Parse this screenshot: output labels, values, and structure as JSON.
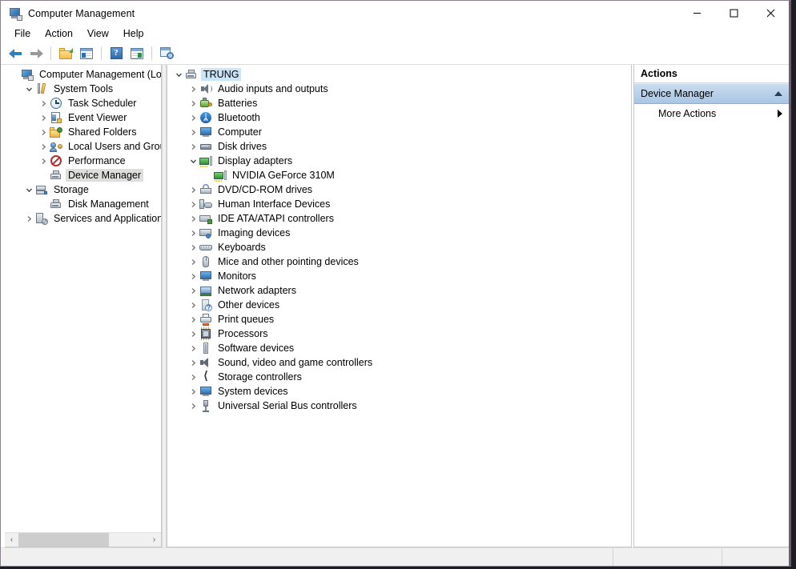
{
  "window": {
    "title": "Computer Management",
    "icon": "computer-management-icon",
    "controls": {
      "minimize": "minimize",
      "maximize": "maximize",
      "close": "close"
    }
  },
  "menubar": {
    "items": [
      {
        "label": "File"
      },
      {
        "label": "Action"
      },
      {
        "label": "View"
      },
      {
        "label": "Help"
      }
    ]
  },
  "toolbar": {
    "items": [
      {
        "name": "back-button",
        "icon": "back-arrow-icon"
      },
      {
        "name": "forward-button",
        "icon": "forward-arrow-icon"
      },
      {
        "name": "up-folder-button",
        "icon": "folder-up-icon"
      },
      {
        "name": "show-hide-tree-button",
        "icon": "console-tree-icon"
      },
      {
        "name": "help-button",
        "icon": "help-icon"
      },
      {
        "name": "show-hide-actions-button",
        "icon": "action-pane-icon"
      },
      {
        "name": "export-list-button",
        "icon": "export-list-icon"
      }
    ]
  },
  "console_tree": {
    "items": [
      {
        "label": "Computer Management (Local",
        "icon": "computer-management-icon",
        "indent": 0,
        "expander": "none",
        "selected": false
      },
      {
        "label": "System Tools",
        "icon": "system-tools-icon",
        "indent": 1,
        "expander": "expanded",
        "selected": false
      },
      {
        "label": "Task Scheduler",
        "icon": "clock-icon",
        "indent": 2,
        "expander": "collapsed",
        "selected": false
      },
      {
        "label": "Event Viewer",
        "icon": "event-viewer-icon",
        "indent": 2,
        "expander": "collapsed",
        "selected": false
      },
      {
        "label": "Shared Folders",
        "icon": "shared-folders-icon",
        "indent": 2,
        "expander": "collapsed",
        "selected": false
      },
      {
        "label": "Local Users and Groups",
        "icon": "users-icon",
        "indent": 2,
        "expander": "collapsed",
        "selected": false
      },
      {
        "label": "Performance",
        "icon": "performance-icon",
        "indent": 2,
        "expander": "collapsed",
        "selected": false
      },
      {
        "label": "Device Manager",
        "icon": "device-manager-icon",
        "indent": 2,
        "expander": "none",
        "selected": true
      },
      {
        "label": "Storage",
        "icon": "storage-icon",
        "indent": 1,
        "expander": "expanded",
        "selected": false
      },
      {
        "label": "Disk Management",
        "icon": "disk-management-icon",
        "indent": 2,
        "expander": "none",
        "selected": false
      },
      {
        "label": "Services and Applications",
        "icon": "services-icon",
        "indent": 1,
        "expander": "collapsed",
        "selected": false
      }
    ],
    "hscroll": {
      "left_arrow": "‹",
      "right_arrow": "›"
    }
  },
  "device_tree": {
    "items": [
      {
        "label": "TRUNG",
        "icon": "device-manager-icon",
        "indent": 0,
        "expander": "expanded",
        "selected": true
      },
      {
        "label": "Audio inputs and outputs",
        "icon": "speaker-icon",
        "indent": 1,
        "expander": "collapsed",
        "selected": false
      },
      {
        "label": "Batteries",
        "icon": "battery-icon",
        "indent": 1,
        "expander": "collapsed",
        "selected": false
      },
      {
        "label": "Bluetooth",
        "icon": "bluetooth-icon",
        "indent": 1,
        "expander": "collapsed",
        "selected": false
      },
      {
        "label": "Computer",
        "icon": "computer-icon",
        "indent": 1,
        "expander": "collapsed",
        "selected": false
      },
      {
        "label": "Disk drives",
        "icon": "disk-drive-icon",
        "indent": 1,
        "expander": "collapsed",
        "selected": false
      },
      {
        "label": "Display adapters",
        "icon": "display-adapter-icon",
        "indent": 1,
        "expander": "expanded",
        "selected": false
      },
      {
        "label": "NVIDIA GeForce 310M",
        "icon": "display-adapter-icon",
        "indent": 2,
        "expander": "none",
        "selected": false
      },
      {
        "label": "DVD/CD-ROM drives",
        "icon": "dvd-drive-icon",
        "indent": 1,
        "expander": "collapsed",
        "selected": false
      },
      {
        "label": "Human Interface Devices",
        "icon": "hid-icon",
        "indent": 1,
        "expander": "collapsed",
        "selected": false
      },
      {
        "label": "IDE ATA/ATAPI controllers",
        "icon": "ide-controller-icon",
        "indent": 1,
        "expander": "collapsed",
        "selected": false
      },
      {
        "label": "Imaging devices",
        "icon": "imaging-device-icon",
        "indent": 1,
        "expander": "collapsed",
        "selected": false
      },
      {
        "label": "Keyboards",
        "icon": "keyboard-icon",
        "indent": 1,
        "expander": "collapsed",
        "selected": false
      },
      {
        "label": "Mice and other pointing devices",
        "icon": "mouse-icon",
        "indent": 1,
        "expander": "collapsed",
        "selected": false
      },
      {
        "label": "Monitors",
        "icon": "monitor-icon",
        "indent": 1,
        "expander": "collapsed",
        "selected": false
      },
      {
        "label": "Network adapters",
        "icon": "network-adapter-icon",
        "indent": 1,
        "expander": "collapsed",
        "selected": false
      },
      {
        "label": "Other devices",
        "icon": "other-device-icon",
        "indent": 1,
        "expander": "collapsed",
        "selected": false
      },
      {
        "label": "Print queues",
        "icon": "printer-icon",
        "indent": 1,
        "expander": "collapsed",
        "selected": false
      },
      {
        "label": "Processors",
        "icon": "processor-icon",
        "indent": 1,
        "expander": "collapsed",
        "selected": false
      },
      {
        "label": "Software devices",
        "icon": "software-device-icon",
        "indent": 1,
        "expander": "collapsed",
        "selected": false
      },
      {
        "label": "Sound, video and game controllers",
        "icon": "sound-video-game-icon",
        "indent": 1,
        "expander": "collapsed",
        "selected": false
      },
      {
        "label": "Storage controllers",
        "icon": "storage-controller-icon",
        "indent": 1,
        "expander": "collapsed",
        "selected": false
      },
      {
        "label": "System devices",
        "icon": "system-device-icon",
        "indent": 1,
        "expander": "collapsed",
        "selected": false
      },
      {
        "label": "Universal Serial Bus controllers",
        "icon": "usb-controller-icon",
        "indent": 1,
        "expander": "collapsed",
        "selected": false
      }
    ]
  },
  "actions_pane": {
    "title": "Actions",
    "group": {
      "label": "Device Manager",
      "collapse_icon": "triangle-up-icon"
    },
    "items": [
      {
        "label": "More Actions",
        "submenu_icon": "triangle-right-icon"
      }
    ]
  },
  "statusbar": {
    "cell1": "",
    "cell2": "",
    "cell3": ""
  },
  "colors": {
    "selection_blue": "#cce4f7",
    "selection_grey": "#dededc",
    "actions_group": "#a9c6e4",
    "window_frame": "#6e5d6e"
  }
}
